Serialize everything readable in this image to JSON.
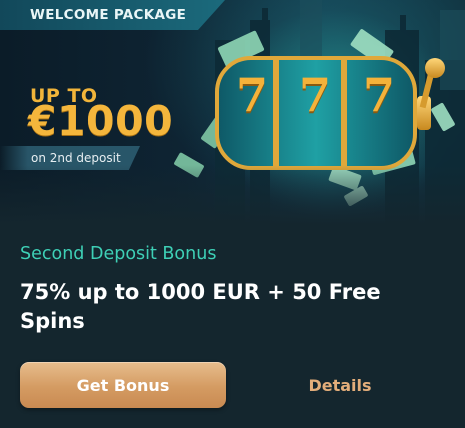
{
  "banner": {
    "tag": "WELCOME PACKAGE",
    "up_to": "UP TO",
    "amount": "€1000",
    "sub": "on 2nd deposit",
    "reel_symbols": [
      "7",
      "7",
      "7"
    ]
  },
  "offer": {
    "subtitle": "Second Deposit Bonus",
    "title": "75% up to 1000 EUR + 50 Free Spins"
  },
  "actions": {
    "primary_label": "Get Bonus",
    "secondary_label": "Details"
  },
  "colors": {
    "background": "#14262e",
    "accent_teal": "#3ed0b6",
    "gold": "#f4b63c",
    "button": "#d49b62",
    "link": "#e2ad7a"
  }
}
